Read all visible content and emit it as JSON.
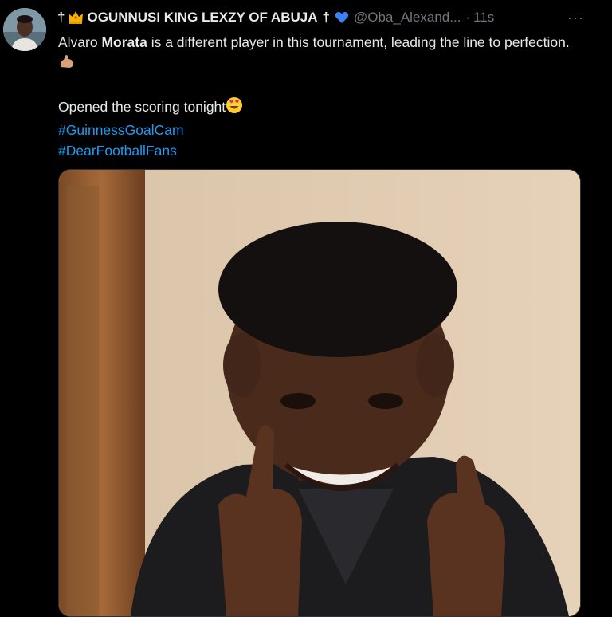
{
  "tweet": {
    "author": {
      "name_prefix": "†",
      "name": "OGUNNUSI KING LEXZY OF ABUJA",
      "name_suffix": "†",
      "handle": "@Oba_Alexand...",
      "verified_color": "#3b82f6"
    },
    "separator": "·",
    "time": "11s",
    "more": "···",
    "text": {
      "line1_a": "Alvaro ",
      "line1_bold": "Morata",
      "line1_b": " is a different player in this tournament, leading the line to perfection.",
      "line2": "Opened the scoring tonight",
      "hashtags": [
        "#GuinnessGoalCam",
        "#DearFootballFans"
      ]
    },
    "icons": [
      "crown-icon",
      "verified-heart-icon",
      "flexed-biceps-emoji",
      "heart-eyes-emoji",
      "more-icon"
    ],
    "colors": {
      "link": "#1d9bf0",
      "secondary": "#71767b",
      "text": "#e7e9ea",
      "background": "#000000"
    }
  }
}
